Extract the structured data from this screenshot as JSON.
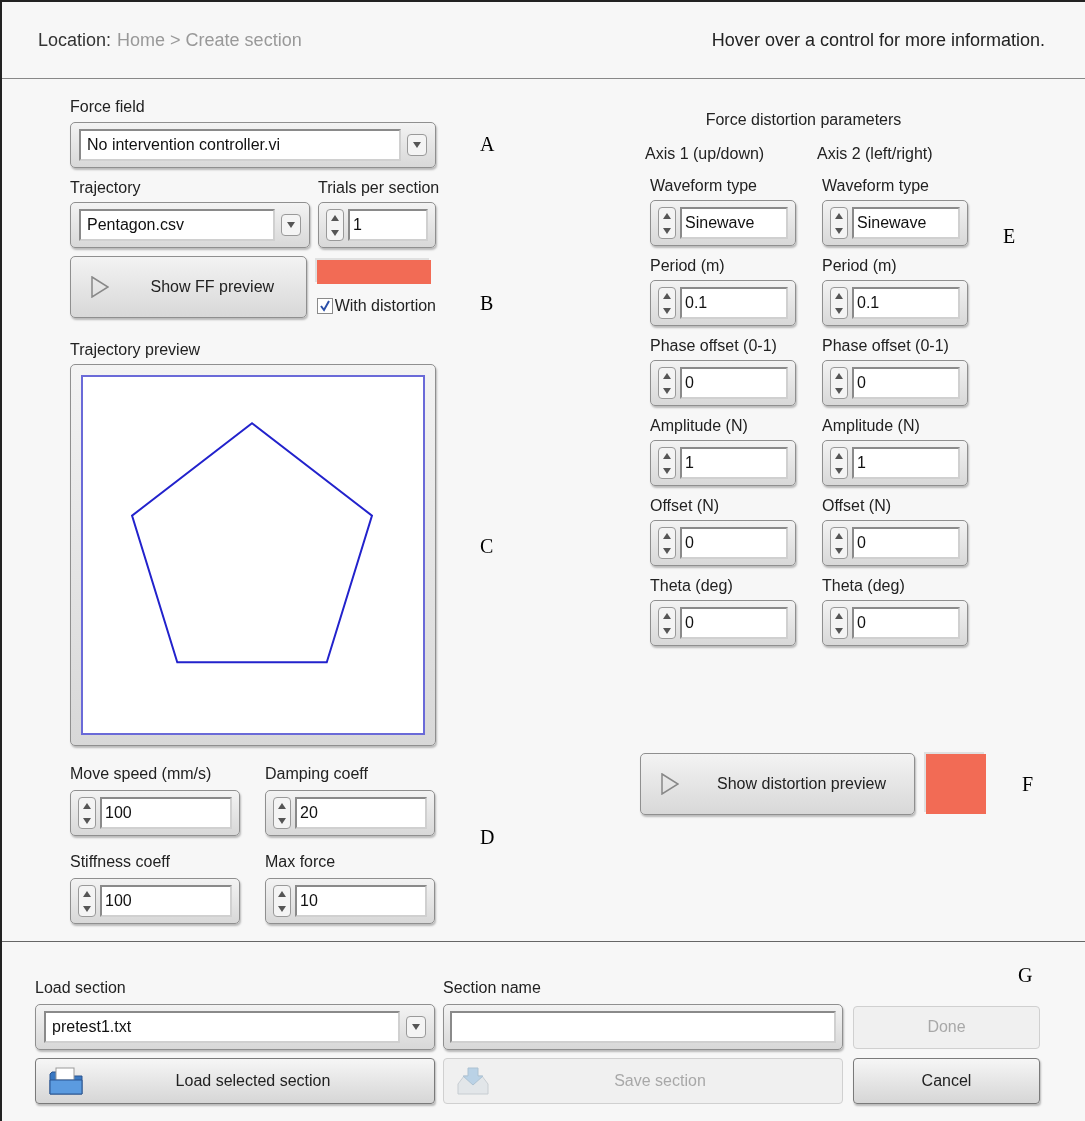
{
  "location": {
    "label": "Location:",
    "path": "Home > Create section"
  },
  "hint": "Hover over a control for more information.",
  "force_field": {
    "label": "Force field",
    "value": "No intervention controller.vi"
  },
  "trajectory": {
    "label": "Trajectory",
    "value": "Pentagon.csv"
  },
  "trials": {
    "label": "Trials per section",
    "value": "1"
  },
  "ff_preview": {
    "button": "Show FF preview",
    "indicator_lit": true,
    "with_distortion": {
      "label": "With distortion",
      "checked": true
    }
  },
  "trajectory_preview": {
    "label": "Trajectory preview"
  },
  "motion_params": [
    {
      "label": "Move speed (mm/s)",
      "value": "100"
    },
    {
      "label": "Damping coeff",
      "value": "20"
    },
    {
      "label": "Stiffness coeff",
      "value": "100"
    },
    {
      "label": "Max force",
      "value": "10"
    }
  ],
  "distortion": {
    "title": "Force distortion parameters",
    "axes": [
      {
        "label": "Axis 1 (up/down)",
        "params": [
          {
            "label": "Waveform type",
            "value": "Sinewave"
          },
          {
            "label": "Period (m)",
            "value": "0.1"
          },
          {
            "label": "Phase offset (0-1)",
            "value": "0"
          },
          {
            "label": "Amplitude (N)",
            "value": "1"
          },
          {
            "label": "Offset (N)",
            "value": "0"
          },
          {
            "label": "Theta (deg)",
            "value": "0"
          }
        ]
      },
      {
        "label": "Axis 2 (left/right)",
        "params": [
          {
            "label": "Waveform type",
            "value": "Sinewave"
          },
          {
            "label": "Period (m)",
            "value": "0.1"
          },
          {
            "label": "Phase offset (0-1)",
            "value": "0"
          },
          {
            "label": "Amplitude (N)",
            "value": "1"
          },
          {
            "label": "Offset (N)",
            "value": "0"
          },
          {
            "label": "Theta (deg)",
            "value": "0"
          }
        ]
      }
    ]
  },
  "distortion_preview": {
    "button": "Show distortion preview",
    "indicator_lit": true
  },
  "annotations": [
    "A",
    "B",
    "C",
    "D",
    "E",
    "F",
    "G"
  ],
  "load_section": {
    "label": "Load section",
    "value": "pretest1.txt"
  },
  "section_name": {
    "label": "Section name"
  },
  "buttons": [
    {
      "label": "Done",
      "disabled": true
    },
    {
      "label": "Load selected section",
      "disabled": false,
      "kind": "folder"
    },
    {
      "label": "Save section",
      "disabled": true,
      "kind": "save"
    },
    {
      "label": "Cancel",
      "disabled": false
    }
  ]
}
